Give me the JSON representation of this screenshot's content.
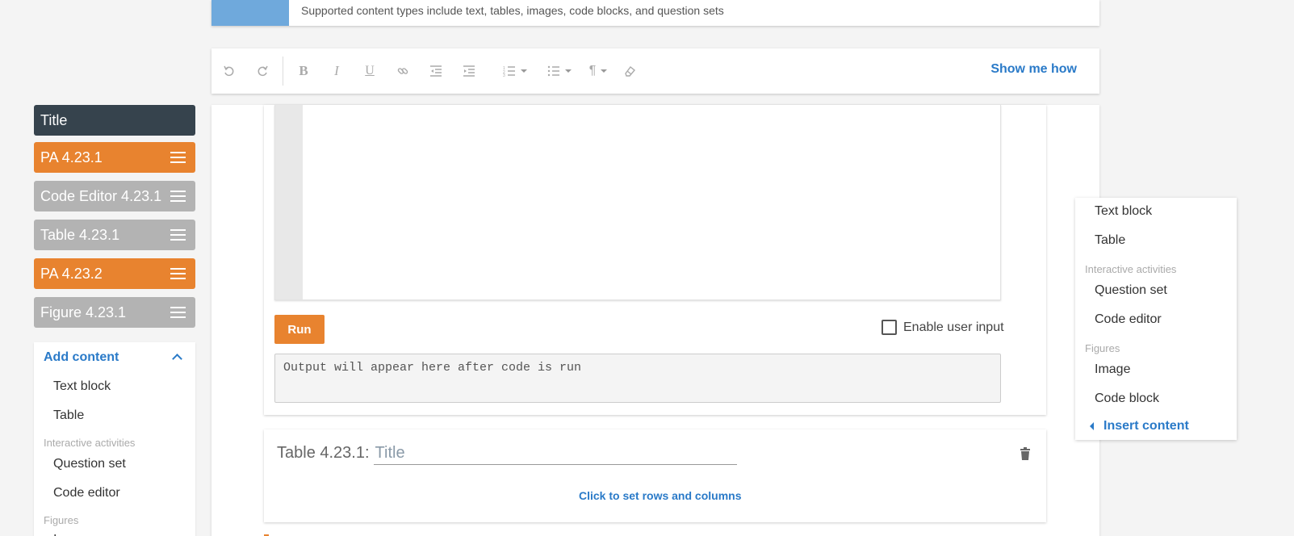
{
  "banner": {
    "text": "Supported content types include text, tables, images, code blocks, and question sets"
  },
  "toolbar": {
    "show_me_how": "Show me how",
    "icons": [
      "undo-icon",
      "redo-icon",
      "bold-icon",
      "italic-icon",
      "underline-icon",
      "link-icon",
      "outdent-icon",
      "indent-icon",
      "ordered-list-icon",
      "bullet-list-icon",
      "paragraph-icon",
      "clear-format-icon"
    ]
  },
  "sidebar": {
    "items": [
      {
        "label": "Title",
        "type": "title"
      },
      {
        "label": "PA 4.23.1",
        "type": "orange"
      },
      {
        "label": "Code Editor 4.23.1",
        "type": "gray"
      },
      {
        "label": "Table 4.23.1",
        "type": "gray"
      },
      {
        "label": "PA 4.23.2",
        "type": "orange"
      },
      {
        "label": "Figure 4.23.1",
        "type": "gray"
      }
    ],
    "add_content": {
      "header": "Add content",
      "text_block": "Text block",
      "table": "Table",
      "cat_interactive": "Interactive activities",
      "question_set": "Question set",
      "code_editor": "Code editor",
      "cat_figures": "Figures",
      "image_partial": "I"
    }
  },
  "editor": {
    "run_label": "Run",
    "enable_input_label": "Enable user input",
    "enable_input_checked": false,
    "output_placeholder": "Output will appear here after code is run"
  },
  "table_block": {
    "prefix": "Table 4.23.1:",
    "title_placeholder": "Title",
    "set_rows_label": "Click to set rows and columns"
  },
  "insert_menu": {
    "text_block": "Text block",
    "table": "Table",
    "cat_interactive": "Interactive activities",
    "question_set": "Question set",
    "code_editor": "Code editor",
    "cat_figures": "Figures",
    "image": "Image",
    "code_block": "Code block",
    "insert_content": "Insert content"
  },
  "colors": {
    "accent_blue": "#2a7ac8",
    "orange": "#e8832f",
    "dark": "#36434d",
    "gray_item": "#b3b3b3",
    "banner_swatch": "#6fa9dc"
  }
}
